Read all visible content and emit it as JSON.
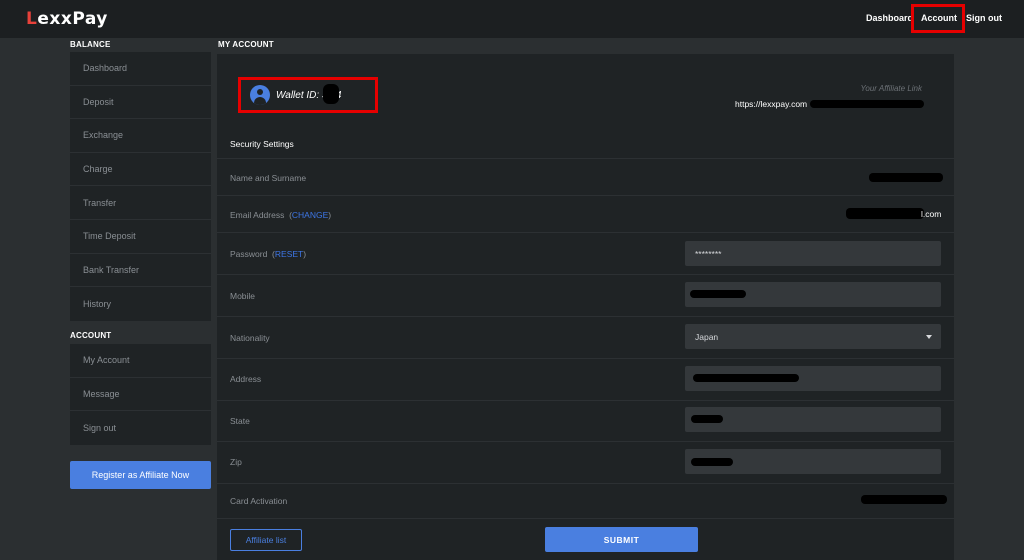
{
  "brand": {
    "logo_part1": "L",
    "logo_part2": "exx",
    "logo_part3": "Pay"
  },
  "header": {
    "nav": {
      "dashboard": "Dashboard",
      "account": "Account",
      "sign_out": "Sign out"
    }
  },
  "sidebar": {
    "balance_title": "BALANCE",
    "balance_items": [
      "Dashboard",
      "Deposit",
      "Exchange",
      "Charge",
      "Transfer",
      "Time Deposit",
      "Bank Transfer",
      "History"
    ],
    "account_title": "ACCOUNT",
    "account_items": [
      "My Account",
      "Message",
      "Sign out"
    ],
    "register_affiliate": "Register as Affiliate Now"
  },
  "main": {
    "title": "MY ACCOUNT",
    "wallet_id": "Wallet ID: 3        74",
    "affiliate_link_label": "Your Affiliate Link",
    "affiliate_link_prefix": "https://lexxpay.com",
    "security_heading": "Security Settings",
    "fields": {
      "name_label": "Name and Surname",
      "email_label": "Email Address",
      "email_action": "CHANGE",
      "email_suffix": "l.com",
      "password_label": "Password",
      "password_action": "RESET",
      "password_value": "********",
      "mobile_label": "Mobile",
      "nationality_label": "Nationality",
      "nationality_value": "Japan",
      "address_label": "Address",
      "state_label": "State",
      "zip_label": "Zip",
      "card_activation_label": "Card Activation"
    },
    "affiliate_list_button": "Affiliate list",
    "submit_button": "SUBMIT"
  },
  "colors": {
    "accent": "#4a7fe0",
    "highlight": "#e60000",
    "brand_red": "#e8413a"
  }
}
